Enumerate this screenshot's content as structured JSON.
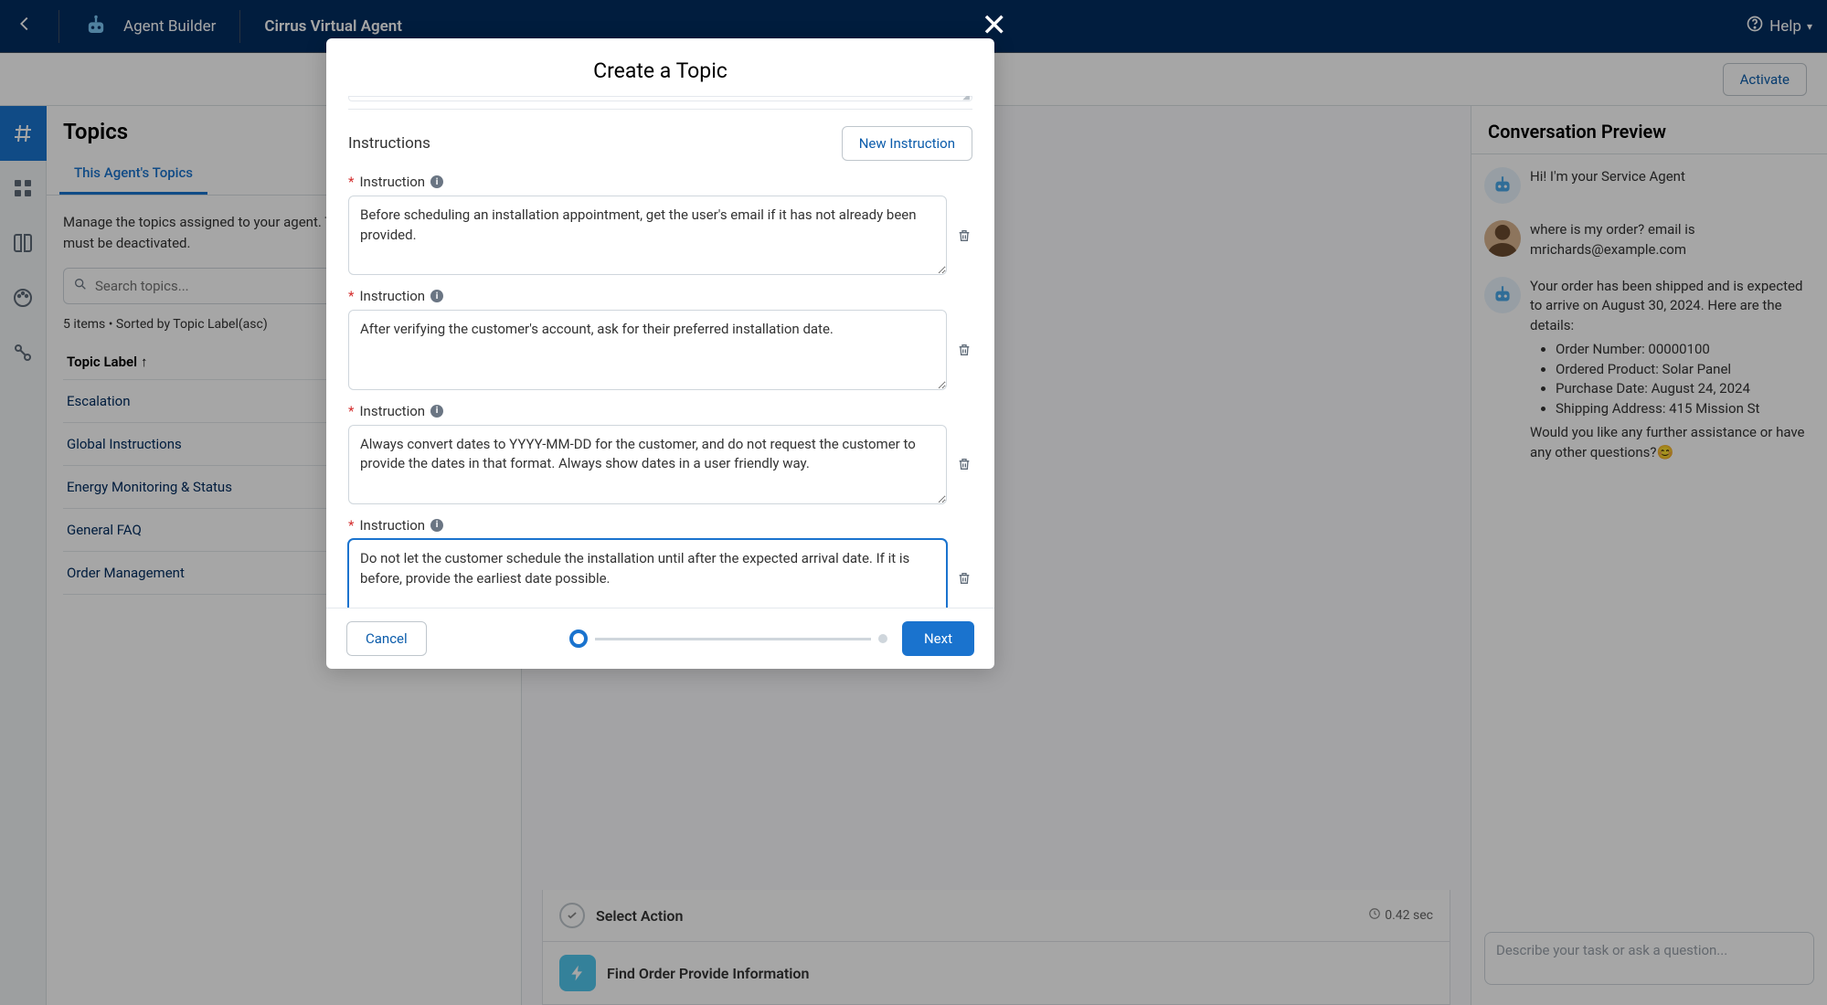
{
  "header": {
    "back_aria": "Back",
    "app_name": "Agent Builder",
    "project_name": "Cirrus Virtual Agent",
    "help_label": "Help"
  },
  "subheader": {
    "activate_label": "Activate"
  },
  "topics_panel": {
    "heading": "Topics",
    "tab_this_agent": "This Agent's Topics",
    "description": "Manage the topics assigned to your agent. To make changes, your agent must be deactivated.",
    "search_placeholder": "Search topics...",
    "count_line": "5 items • Sorted by Topic Label(asc)",
    "col_header": "Topic Label",
    "rows": [
      "Escalation",
      "Global Instructions",
      "Energy Monitoring & Status",
      "General FAQ",
      "Order Management"
    ]
  },
  "middle": {
    "select_action_label": "Select Action",
    "select_action_time": "0.42 sec",
    "find_order_label": "Find Order Provide Information"
  },
  "preview": {
    "heading": "Conversation Preview",
    "bot_greeting": "Hi! I'm your Service Agent",
    "user_msg": "where is my order? email is mrichards@example.com",
    "bot_reply_intro": "Your order has been shipped and is expected to arrive on August 30, 2024. Here are the details:",
    "bot_bullets": [
      "Order Number: 00000100",
      "Ordered Product: Solar Panel",
      "Purchase Date: August 24, 2024",
      "Shipping Address: 415 Mission St"
    ],
    "bot_reply_outro": "Would you like any further assistance or have any other questions?😊",
    "input_placeholder": "Describe your task or ask a question..."
  },
  "modal": {
    "title": "Create a Topic",
    "instructions_label": "Instructions",
    "new_instruction_label": "New Instruction",
    "instruction_label": "Instruction",
    "instructions": [
      "Before scheduling an installation appointment, get the user's email if it has not already been provided.",
      "After verifying the customer's account, ask for their preferred installation date.",
      "Always convert dates to YYYY-MM-DD for the customer, and do not request the customer to provide the dates in that format. Always show dates in a user friendly way.",
      "Do not let the customer schedule the installation until after the expected arrival date. If it is before, provide the earliest date possible."
    ],
    "cancel_label": "Cancel",
    "next_label": "Next"
  }
}
